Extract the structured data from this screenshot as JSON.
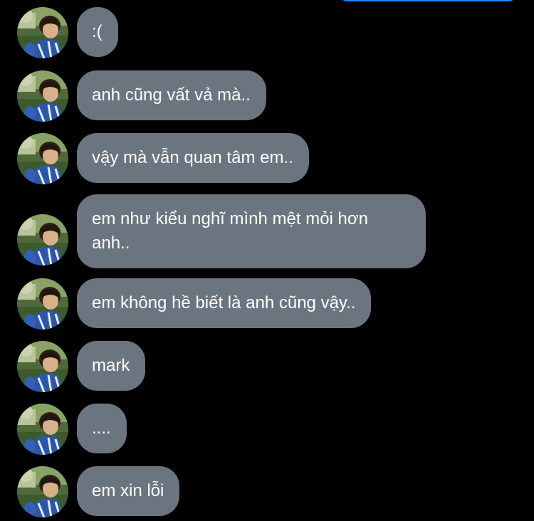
{
  "colors": {
    "background": "#000000",
    "bubble": "#6b7580",
    "bubble_text": "#ffffff",
    "sent_bubble": "#1a8cff"
  },
  "avatar": {
    "icon": "profile-photo-icon"
  },
  "messages": [
    {
      "text": ":("
    },
    {
      "text": "anh cũng vất vả mà.."
    },
    {
      "text": "vậy mà vẫn quan tâm em.."
    },
    {
      "text": "em như kiểu nghĩ mình mệt mỏi hơn anh.."
    },
    {
      "text": "em không hề biết là anh cũng vậy.."
    },
    {
      "text": "mark"
    },
    {
      "text": "...."
    },
    {
      "text": "em xin lỗi"
    }
  ]
}
